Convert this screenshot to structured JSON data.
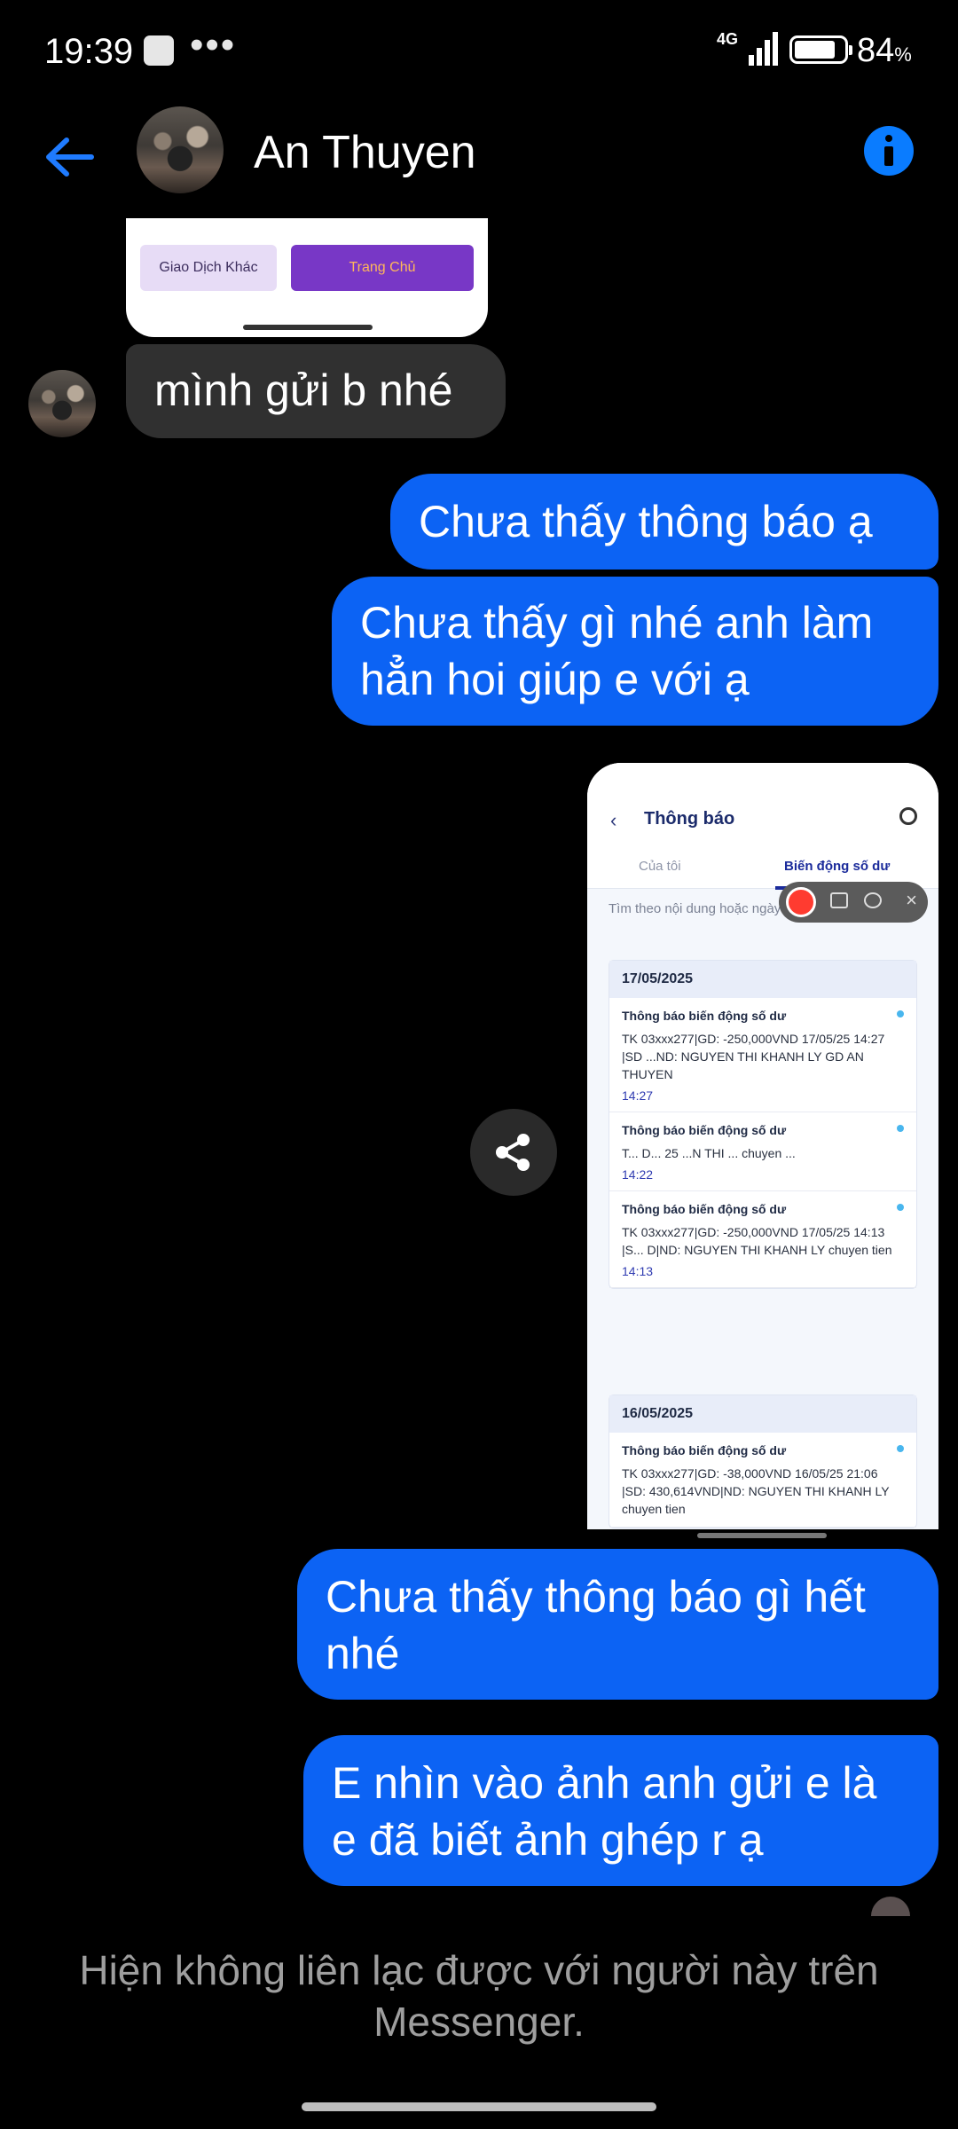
{
  "status_bar": {
    "time": "19:39",
    "network": "4G",
    "battery": "84",
    "battery_unit": "%"
  },
  "header": {
    "contact_name": "An Thuyen"
  },
  "shared_top_screenshot": {
    "button_other": "Giao Dịch Khác",
    "button_home": "Trang Chủ"
  },
  "messages": [
    {
      "direction": "incoming",
      "text": "mình gửi b nhé"
    },
    {
      "direction": "outgoing",
      "text": "Chưa thấy thông báo ạ"
    },
    {
      "direction": "outgoing",
      "text": "Chưa thấy gì nhé anh làm hẳn hoi giúp e với ạ"
    },
    {
      "direction": "outgoing",
      "text": "Chưa thấy thông báo gì hết nhé"
    },
    {
      "direction": "outgoing",
      "text": "E nhìn vào ảnh anh gửi e là e  đã biết ảnh ghép r ạ"
    }
  ],
  "shared_screenshot": {
    "title": "Thông báo",
    "tabs": [
      "Của tôi",
      "Biến động số dư"
    ],
    "search_placeholder": "Tìm theo nội dung hoặc ngày",
    "groups": [
      {
        "date": "17/05/2025",
        "items": [
          {
            "title": "Thông báo biến động số dư",
            "body": "TK 03xxx277|GD: -250,000VND 17/05/25 14:27 |SD ...ND: NGUYEN THI KHANH LY GD AN THUYEN",
            "time": "14:27"
          },
          {
            "title": "Thông báo biến động số dư",
            "body": "T... D... 25 ...N THI ... chuyen ...",
            "time": "14:22"
          },
          {
            "title": "Thông báo biến động số dư",
            "body": "TK 03xxx277|GD: -250,000VND 17/05/25 14:13 |S... D|ND: NGUYEN THI KHANH LY chuyen tien",
            "time": "14:13"
          }
        ]
      },
      {
        "date": "16/05/2025",
        "items": [
          {
            "title": "Thông báo biến động số dư",
            "body": "TK 03xxx277|GD: -38,000VND 16/05/25 21:06 |SD: 430,614VND|ND: NGUYEN THI KHANH LY chuyen tien",
            "time": ""
          }
        ]
      }
    ]
  },
  "footer": {
    "notice": "Hiện không liên lạc được với người này trên Messenger."
  },
  "colors": {
    "outgoing_bubble": "#0c63f4",
    "incoming_bubble": "#303030",
    "accent": "#0a7cff",
    "background": "#000000"
  }
}
